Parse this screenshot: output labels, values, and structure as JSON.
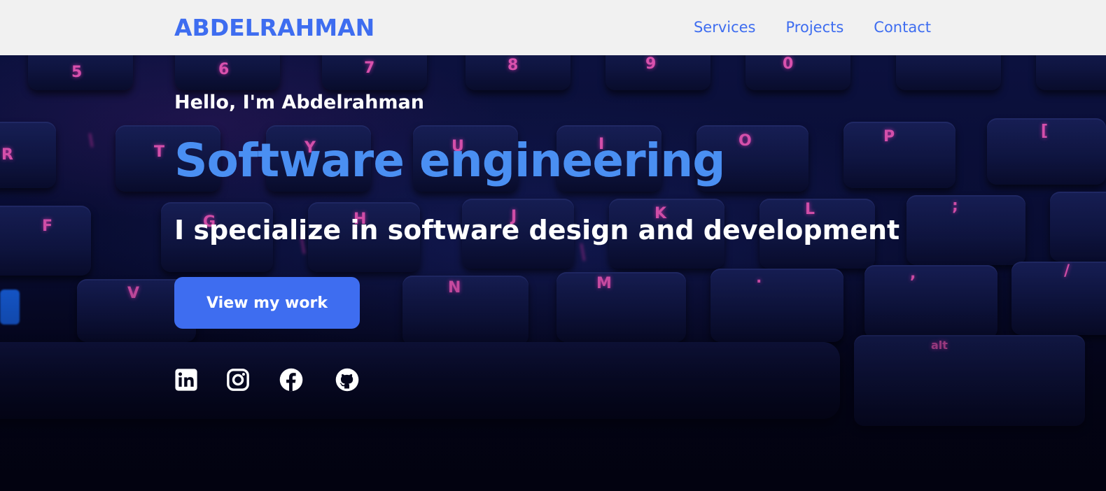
{
  "header": {
    "brand": "ABDELRAHMAN",
    "nav": [
      {
        "label": "Services"
      },
      {
        "label": "Projects"
      },
      {
        "label": "Contact"
      }
    ]
  },
  "hero": {
    "greeting": "Hello, I'm Abdelrahman",
    "headline": "Software engineering",
    "tagline": "I specialize in software design and development",
    "cta_label": "View my work",
    "background": "keyboard-photo",
    "socials": [
      {
        "icon": "linkedin-icon"
      },
      {
        "icon": "instagram-icon"
      },
      {
        "icon": "facebook-icon"
      },
      {
        "icon": "github-icon"
      }
    ]
  },
  "colors": {
    "accent": "#3e6df0",
    "headline": "#4a8ff2",
    "header_bg": "#f1f1f1",
    "key_glow": "#ff5fc8"
  }
}
